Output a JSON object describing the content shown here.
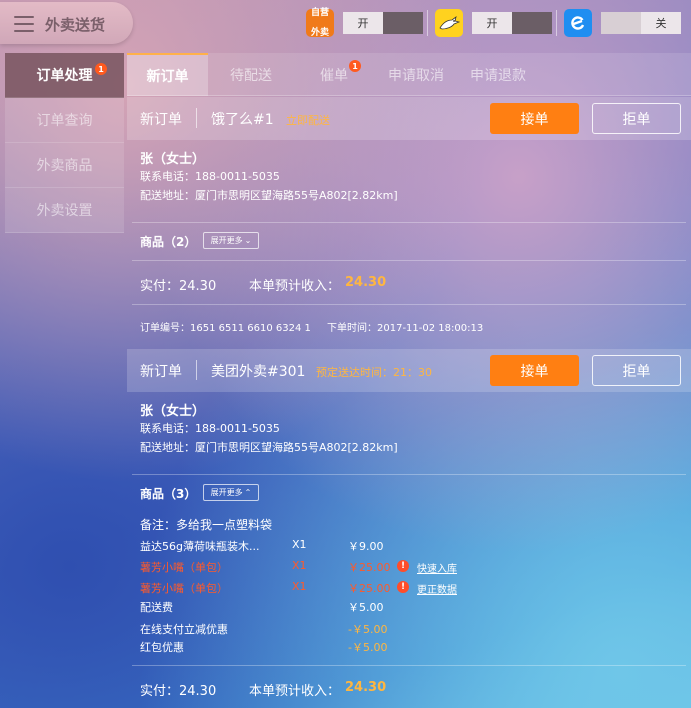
{
  "app": {
    "title": "外卖送货"
  },
  "platforms": [
    {
      "name": "own-delivery",
      "icon_label": "自营\n外卖",
      "icon_color": "#f07a1a",
      "toggle_label": "开",
      "state": "on"
    },
    {
      "name": "meituan",
      "icon_color": "#ffd21f",
      "toggle_label": "开",
      "state": "on"
    },
    {
      "name": "eleme",
      "icon_color": "#1f8ef1",
      "toggle_label": "关",
      "state": "off"
    }
  ],
  "sidebar": {
    "items": [
      {
        "label": "订单处理",
        "badge": "1"
      },
      {
        "label": "订单查询"
      },
      {
        "label": "外卖商品"
      },
      {
        "label": "外卖设置"
      }
    ]
  },
  "tabs": [
    {
      "label": "新订单"
    },
    {
      "label": "待配送"
    },
    {
      "label": "催单",
      "badge": "1"
    },
    {
      "label": "申请取消"
    },
    {
      "label": "申请退款"
    }
  ],
  "orders": [
    {
      "status": "新订单",
      "platform": "饿了么#1",
      "note": "立即配送",
      "accept": "接单",
      "reject": "拒单",
      "customer": "张（女士）",
      "phone": "联系电话：188-0011-5035",
      "address": "配送地址：厦门市思明区望海路55号A802[2.82km]",
      "goods_label": "商品（2）",
      "expand_label": "展开更多",
      "actual": "实付：24.30",
      "income_label": "本单预计收入：",
      "income_value": "24.30",
      "order_no": "订单编号：1651 6511 6610 6324 1",
      "order_time": "下单时间：2017-11-02 18:00:13"
    },
    {
      "status": "新订单",
      "platform": "美团外卖#301",
      "note": "预定送达时间：21：30",
      "accept": "接单",
      "reject": "拒单",
      "customer": "张（女士）",
      "phone": "联系电话：188-0011-5035",
      "address": "配送地址：厦门市思明区望海路55号A802[2.82km]",
      "goods_label": "商品（3）",
      "expand_label": "展开更多",
      "remark": "备注：多给我一点塑料袋",
      "items": [
        {
          "name": "益达56g薄荷味瓶装木...",
          "qty": "X1",
          "price": "￥9.00"
        },
        {
          "name": "薯芳小嘴（单包）",
          "qty": "X1",
          "price": "￥25.00",
          "warn": true,
          "warn_icon": "!",
          "link": "快速入库"
        },
        {
          "name": "薯芳小嘴（单包）",
          "qty": "X1",
          "price": "￥25.00",
          "warn": true,
          "warn_icon": "!",
          "link": "更正数据"
        },
        {
          "name": "配送费",
          "price": "￥5.00"
        },
        {
          "name": "在线支付立减优惠",
          "price": "-￥5.00",
          "discount": true
        },
        {
          "name": "红包优惠",
          "price": "-￥5.00",
          "discount": true
        }
      ],
      "actual": "实付：24.30",
      "income_label": "本单预计收入：",
      "income_value": "24.30"
    }
  ]
}
